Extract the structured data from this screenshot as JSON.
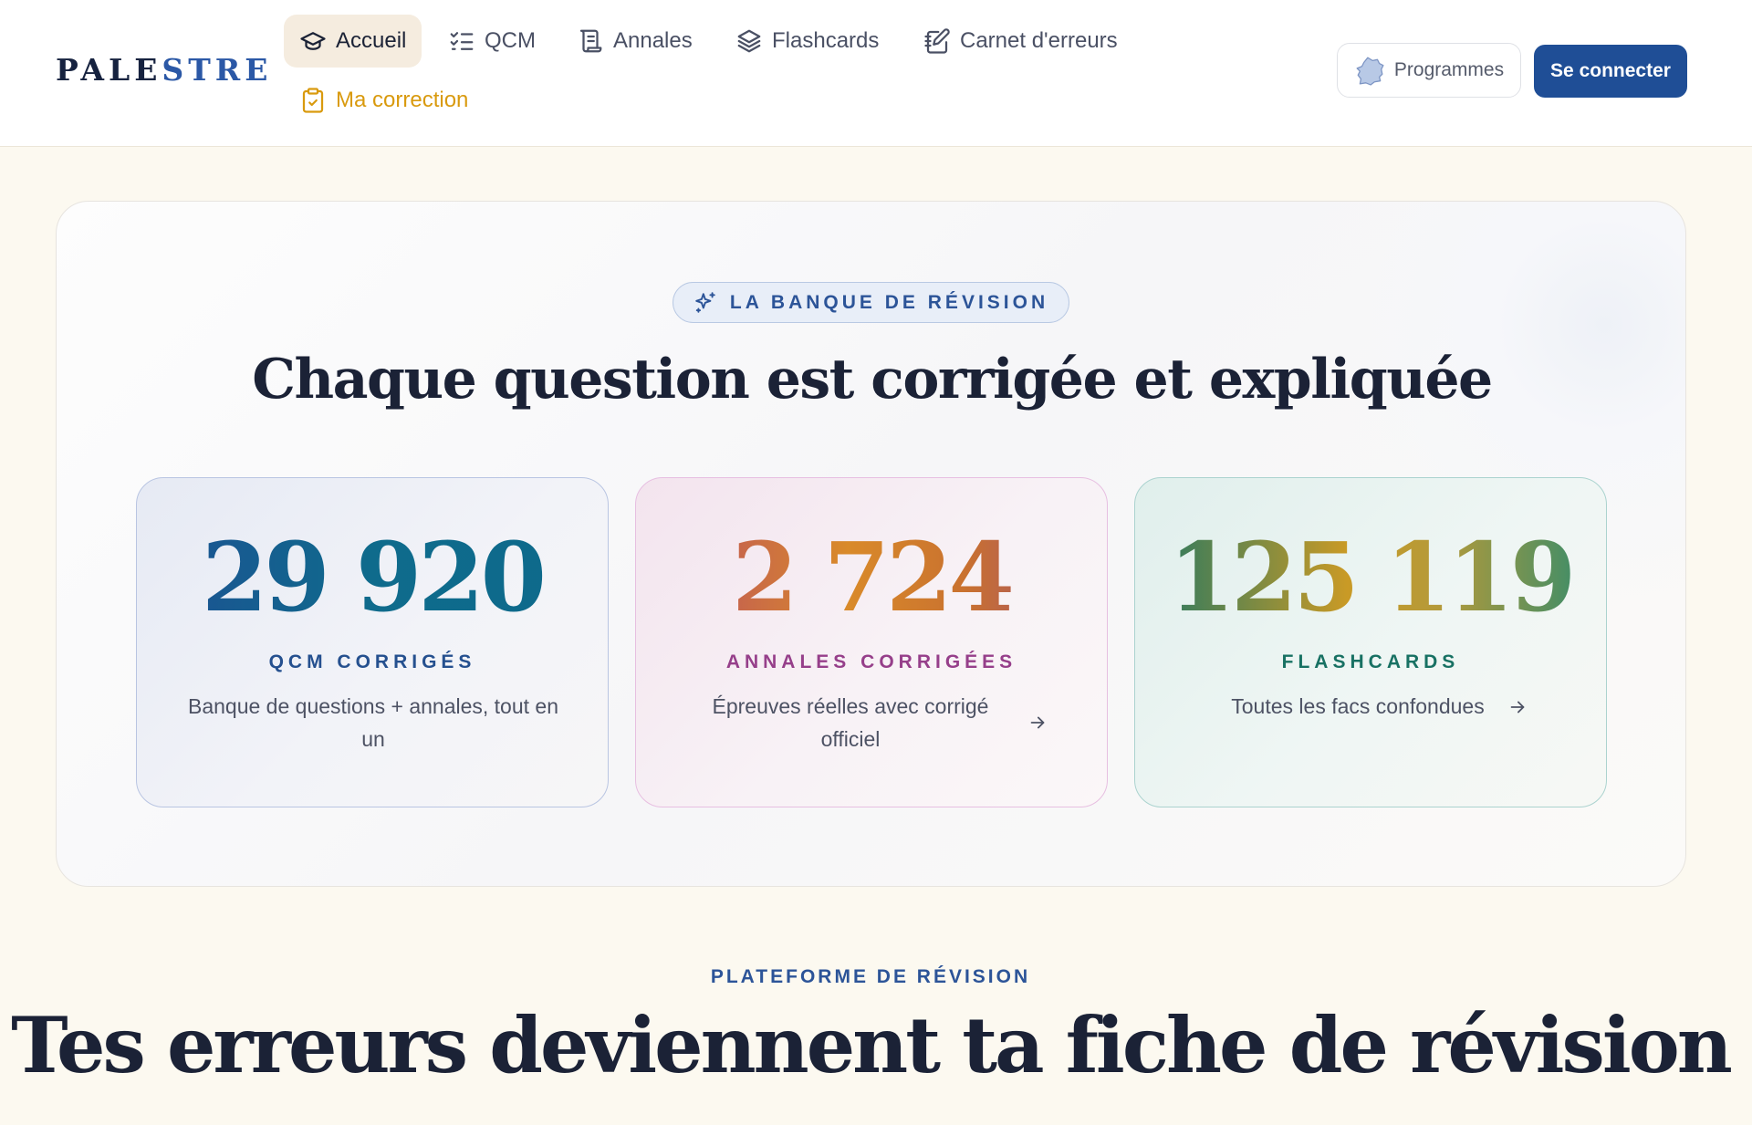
{
  "header": {
    "logo_part1": "PALE",
    "logo_part2": "STRE",
    "nav": [
      {
        "label": "Accueil",
        "icon": "graduation-cap-icon"
      },
      {
        "label": "QCM",
        "icon": "checklist-icon"
      },
      {
        "label": "Annales",
        "icon": "scroll-icon"
      },
      {
        "label": "Flashcards",
        "icon": "layers-icon"
      },
      {
        "label": "Carnet d'erreurs",
        "icon": "notebook-pen-icon"
      },
      {
        "label": "Ma correction",
        "icon": "clipboard-check-icon"
      }
    ],
    "programmes_label": "Programmes",
    "programmes_icon": "france-map-icon",
    "login_label": "Se connecter"
  },
  "hero": {
    "badge": "LA BANQUE DE RÉVISION",
    "title": "Chaque question est corrigée et expliquée",
    "stats": [
      {
        "value": "29 920",
        "label": "QCM CORRIGÉS",
        "description": "Banque de questions + annales, tout en un"
      },
      {
        "value": "2 724",
        "label": "ANNALES CORRIGÉES",
        "description": "Épreuves réelles avec corrigé officiel"
      },
      {
        "value": "125 119",
        "label": "FLASHCARDS",
        "description": "Toutes les facs confondues"
      }
    ]
  },
  "section": {
    "eyebrow": "PLATEFORME DE RÉVISION",
    "title": "Tes erreurs deviennent ta fiche de révision"
  },
  "colors": {
    "brand_blue": "#1f4e96",
    "background": "#fcf9f0",
    "highlight_gold": "#d99a0e"
  }
}
